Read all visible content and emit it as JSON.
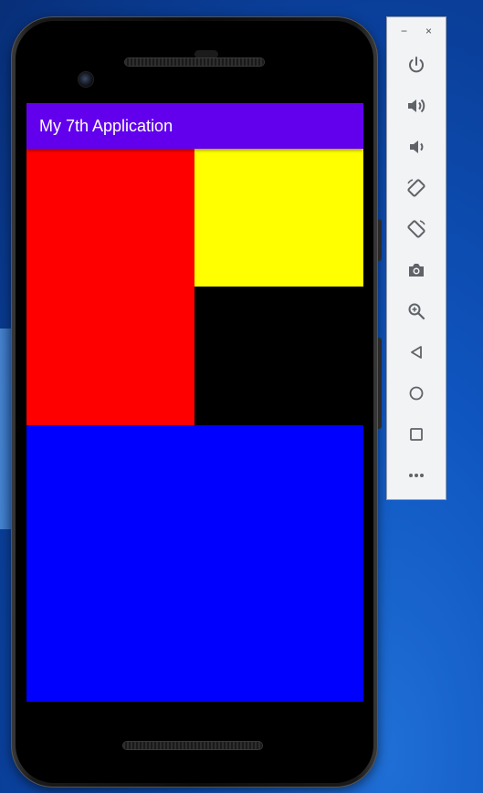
{
  "app": {
    "title": "My 7th Application",
    "colors": {
      "app_bar": "#6200ee",
      "block_top_left": "#ff0000",
      "block_top_right": "#ffff00",
      "block_middle_right": "#000000",
      "block_bottom": "#0000ff"
    }
  },
  "emulator_toolbar": {
    "window_controls": [
      "−",
      "×"
    ],
    "icons": [
      "power-icon",
      "volume-up-icon",
      "volume-down-icon",
      "rotate-left-icon",
      "rotate-right-icon",
      "camera-icon",
      "zoom-icon",
      "back-icon",
      "home-icon",
      "overview-icon",
      "more-icon"
    ]
  }
}
